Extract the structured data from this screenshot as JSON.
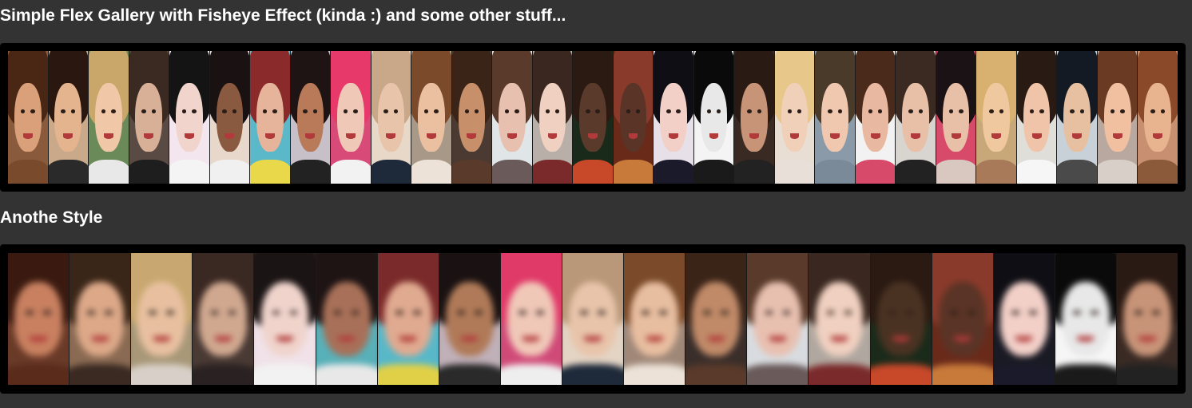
{
  "gallery_one": {
    "title": "Simple Flex Gallery with Fisheye Effect (kinda :) and some other stuff...",
    "photos": [
      {
        "bg": "#8a5a3c",
        "hair": "#4a2614",
        "skin": "#d9a07a",
        "shirt": "#7a4a2c"
      },
      {
        "bg": "#c9a98a",
        "hair": "#2a1810",
        "skin": "#e3b48e",
        "shirt": "#2a2a2a"
      },
      {
        "bg": "#6b8a5a",
        "hair": "#c9a66a",
        "skin": "#f0c8a8",
        "shirt": "#e8e8e8"
      },
      {
        "bg": "#5a4a44",
        "hair": "#3a2a22",
        "skin": "#d8b098",
        "shirt": "#1e1e1e"
      },
      {
        "bg": "#f3e6ee",
        "hair": "#141414",
        "skin": "#f1d4cc",
        "shirt": "#f4f4f4"
      },
      {
        "bg": "#e8d8cc",
        "hair": "#1a1212",
        "skin": "#8a5a40",
        "shirt": "#f0f0f0"
      },
      {
        "bg": "#5ab8c8",
        "hair": "#8a2a2a",
        "skin": "#e6b49a",
        "shirt": "#e8d84a"
      },
      {
        "bg": "#c8c0c8",
        "hair": "#1e1414",
        "skin": "#b87a58",
        "shirt": "#222222"
      },
      {
        "bg": "#d84a78",
        "hair": "#e83a6a",
        "skin": "#f0c8b8",
        "shirt": "#f2f2f2"
      },
      {
        "bg": "#e8d8c8",
        "hair": "#c8a888",
        "skin": "#e8c4aa",
        "shirt": "#1e2a3a"
      },
      {
        "bg": "#a89888",
        "hair": "#7a4a2a",
        "skin": "#eac0a0",
        "shirt": "#ece2d8"
      },
      {
        "bg": "#4a3a32",
        "hair": "#3a2418",
        "skin": "#c8906a",
        "shirt": "#5a3a2a"
      },
      {
        "bg": "#e0e6e8",
        "hair": "#5a3a2a",
        "skin": "#e8c0b0",
        "shirt": "#6a5a5a"
      },
      {
        "bg": "#b8b0a8",
        "hair": "#3a2820",
        "skin": "#f0d0c0",
        "shirt": "#7a2a2a"
      },
      {
        "bg": "#1a2a1a",
        "hair": "#2a1a12",
        "skin": "#5a3a2a",
        "shirt": "#c8482a"
      },
      {
        "bg": "#6a2a1a",
        "hair": "#8a3a2a",
        "skin": "#5a3426",
        "shirt": "#c87a3a"
      },
      {
        "bg": "#e8e0e8",
        "hair": "#0e0e14",
        "skin": "#f2d0c8",
        "shirt": "#1a1a2a"
      },
      {
        "bg": "#f4f4f4",
        "hair": "#0a0a0a",
        "skin": "#e8e8e8",
        "shirt": "#1a1a1a"
      },
      {
        "bg": "#3a2a24",
        "hair": "#2a1a14",
        "skin": "#c89478",
        "shirt": "#222222"
      },
      {
        "bg": "#e8ded4",
        "hair": "#e8c88a",
        "skin": "#f0d0b8",
        "shirt": "#e8e0d8"
      },
      {
        "bg": "#8a9aa8",
        "hair": "#4a3a2a",
        "skin": "#f0c8b0",
        "shirt": "#7a8a98"
      },
      {
        "bg": "#f2f2f2",
        "hair": "#4a2a1a",
        "skin": "#e8b8a0",
        "shirt": "#d84a6a"
      },
      {
        "bg": "#d8d4d0",
        "hair": "#3a2a22",
        "skin": "#e8c0a8",
        "shirt": "#222222"
      },
      {
        "bg": "#d84a6a",
        "hair": "#1a1214",
        "skin": "#e8c0a8",
        "shirt": "#d8c8c0"
      },
      {
        "bg": "#c8a878",
        "hair": "#d8b070",
        "skin": "#f0c8a0",
        "shirt": "#a87a5a"
      },
      {
        "bg": "#e0ded8",
        "hair": "#2a1a14",
        "skin": "#f0c4a8",
        "shirt": "#f6f6f6"
      },
      {
        "bg": "#c8d0d8",
        "hair": "#141a24",
        "skin": "#e6c0a0",
        "shirt": "#4a4a4a"
      },
      {
        "bg": "#b8a8a0",
        "hair": "#6a3a22",
        "skin": "#f0c0a0",
        "shirt": "#d8d0c8"
      },
      {
        "bg": "#c89070",
        "hair": "#8a4a2a",
        "skin": "#e8b490",
        "shirt": "#8a5a3a"
      }
    ]
  },
  "gallery_two": {
    "title": "Anothe Style",
    "photos": [
      {
        "bg": "#6a3a28",
        "hair": "#3a1a10",
        "skin": "#c88060",
        "shirt": "#5a2a1a"
      },
      {
        "bg": "#8a6a52",
        "hair": "#3a2618",
        "skin": "#dca888",
        "shirt": "#3a2a22"
      },
      {
        "bg": "#a89878",
        "hair": "#c8a870",
        "skin": "#e8c0a0",
        "shirt": "#d8d0c8"
      },
      {
        "bg": "#4a3a34",
        "hair": "#3a2822",
        "skin": "#d0a890",
        "shirt": "#2a2222"
      },
      {
        "bg": "#f0e2e8",
        "hair": "#1a1414",
        "skin": "#f0d4cc",
        "shirt": "#f2f2f2"
      },
      {
        "bg": "#58b0b8",
        "hair": "#1e1414",
        "skin": "#a87058",
        "shirt": "#e8e8e8"
      },
      {
        "bg": "#58b8c8",
        "hair": "#7a2a2a",
        "skin": "#e0aa90",
        "shirt": "#e0d048"
      },
      {
        "bg": "#c0b0b8",
        "hair": "#1a1212",
        "skin": "#b07a58",
        "shirt": "#2a2a2a"
      },
      {
        "bg": "#d04a78",
        "hair": "#e03a68",
        "skin": "#f0c8b8",
        "shirt": "#eeeeee"
      },
      {
        "bg": "#e4d4c4",
        "hair": "#b89878",
        "skin": "#e8c4aa",
        "shirt": "#1e2a3a"
      },
      {
        "bg": "#a08878",
        "hair": "#7a4a2a",
        "skin": "#e8bea0",
        "shirt": "#ece2d8"
      },
      {
        "bg": "#3a2e2a",
        "hair": "#3a2418",
        "skin": "#c08a68",
        "shirt": "#5a3a2a"
      },
      {
        "bg": "#d8dce0",
        "hair": "#5a3a2a",
        "skin": "#e8c0b0",
        "shirt": "#6a5a5a"
      },
      {
        "bg": "#b0a8a0",
        "hair": "#3a2820",
        "skin": "#f0d0c0",
        "shirt": "#7a2a2a"
      },
      {
        "bg": "#1a2a1a",
        "hair": "#2a1a12",
        "skin": "#4a3222",
        "shirt": "#c8482a"
      },
      {
        "bg": "#6a2a1a",
        "hair": "#8a3a2a",
        "skin": "#5a3426",
        "shirt": "#c87a3a"
      },
      {
        "bg": "#1a1a24",
        "hair": "#0e0e14",
        "skin": "#f2d0c8",
        "shirt": "#1a1a2a"
      },
      {
        "bg": "#f6f6f6",
        "hair": "#0a0a0a",
        "skin": "#e8e8e8",
        "shirt": "#1a1a1a"
      },
      {
        "bg": "#3a2a24",
        "hair": "#2a1a14",
        "skin": "#c89478",
        "shirt": "#222222"
      }
    ]
  }
}
